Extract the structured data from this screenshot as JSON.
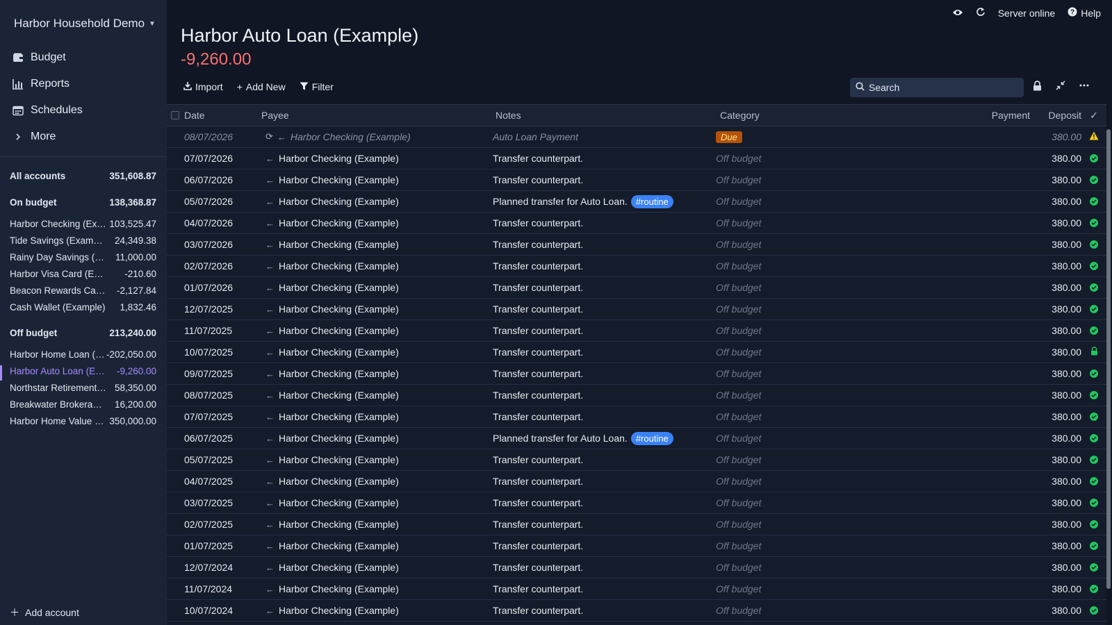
{
  "sidebar": {
    "budget_name": "Harbor Household Demo",
    "nav": [
      {
        "label": "Budget",
        "icon": "wallet-icon"
      },
      {
        "label": "Reports",
        "icon": "bar-chart-icon"
      },
      {
        "label": "Schedules",
        "icon": "calendar-icon"
      },
      {
        "label": "More",
        "icon": "chevron-right-icon"
      }
    ],
    "all_accounts": {
      "name": "All accounts",
      "balance": "351,608.87"
    },
    "on_budget": {
      "name": "On budget",
      "balance": "138,368.87"
    },
    "on_budget_accounts": [
      {
        "name": "Harbor Checking (Example)",
        "balance": "103,525.47"
      },
      {
        "name": "Tide Savings (Example)",
        "balance": "24,349.38"
      },
      {
        "name": "Rainy Day Savings (Example)",
        "balance": "11,000.00"
      },
      {
        "name": "Harbor Visa Card (Example)",
        "balance": "-210.60"
      },
      {
        "name": "Beacon Rewards Card (Example)",
        "balance": "-2,127.84"
      },
      {
        "name": "Cash Wallet (Example)",
        "balance": "1,832.46"
      }
    ],
    "off_budget": {
      "name": "Off budget",
      "balance": "213,240.00"
    },
    "off_budget_accounts": [
      {
        "name": "Harbor Home Loan (Example)",
        "balance": "-202,050.00"
      },
      {
        "name": "Harbor Auto Loan (Example)",
        "balance": "-9,260.00"
      },
      {
        "name": "Northstar Retirement (Example)",
        "balance": "58,350.00"
      },
      {
        "name": "Breakwater Brokerage (Example)",
        "balance": "16,200.00"
      },
      {
        "name": "Harbor Home Value (Example)",
        "balance": "350,000.00"
      }
    ],
    "add_account": "Add account"
  },
  "topbar": {
    "server_status": "Server online",
    "help": "Help"
  },
  "account": {
    "title": "Harbor Auto Loan (Example)",
    "balance": "-9,260.00"
  },
  "toolbar": {
    "import": "Import",
    "add_new": "Add New",
    "filter": "Filter",
    "search_placeholder": "Search"
  },
  "columns": {
    "date": "Date",
    "payee": "Payee",
    "notes": "Notes",
    "category": "Category",
    "payment": "Payment",
    "deposit": "Deposit",
    "cleared": "✓"
  },
  "colors": {
    "accent": "#a78bfa",
    "negative": "#f87171",
    "tag": "#3b82f6",
    "cleared": "#22c55e",
    "due": "#b45309"
  },
  "transactions": [
    {
      "date": "08/07/2026",
      "payee": "Harbor Checking (Example)",
      "notes": "Auto Loan Payment",
      "tag": "",
      "category": "Due",
      "deposit": "380.00",
      "status": "warning",
      "scheduled": true
    },
    {
      "date": "07/07/2026",
      "payee": "Harbor Checking (Example)",
      "notes": "Transfer counterpart.",
      "tag": "",
      "category": "Off budget",
      "deposit": "380.00",
      "status": "cleared"
    },
    {
      "date": "06/07/2026",
      "payee": "Harbor Checking (Example)",
      "notes": "Transfer counterpart.",
      "tag": "",
      "category": "Off budget",
      "deposit": "380.00",
      "status": "cleared"
    },
    {
      "date": "05/07/2026",
      "payee": "Harbor Checking (Example)",
      "notes": "Planned transfer for Auto Loan.",
      "tag": "#routine",
      "category": "Off budget",
      "deposit": "380.00",
      "status": "cleared"
    },
    {
      "date": "04/07/2026",
      "payee": "Harbor Checking (Example)",
      "notes": "Transfer counterpart.",
      "tag": "",
      "category": "Off budget",
      "deposit": "380.00",
      "status": "cleared"
    },
    {
      "date": "03/07/2026",
      "payee": "Harbor Checking (Example)",
      "notes": "Transfer counterpart.",
      "tag": "",
      "category": "Off budget",
      "deposit": "380.00",
      "status": "cleared"
    },
    {
      "date": "02/07/2026",
      "payee": "Harbor Checking (Example)",
      "notes": "Transfer counterpart.",
      "tag": "",
      "category": "Off budget",
      "deposit": "380.00",
      "status": "cleared"
    },
    {
      "date": "01/07/2026",
      "payee": "Harbor Checking (Example)",
      "notes": "Transfer counterpart.",
      "tag": "",
      "category": "Off budget",
      "deposit": "380.00",
      "status": "cleared"
    },
    {
      "date": "12/07/2025",
      "payee": "Harbor Checking (Example)",
      "notes": "Transfer counterpart.",
      "tag": "",
      "category": "Off budget",
      "deposit": "380.00",
      "status": "cleared"
    },
    {
      "date": "11/07/2025",
      "payee": "Harbor Checking (Example)",
      "notes": "Transfer counterpart.",
      "tag": "",
      "category": "Off budget",
      "deposit": "380.00",
      "status": "cleared"
    },
    {
      "date": "10/07/2025",
      "payee": "Harbor Checking (Example)",
      "notes": "Transfer counterpart.",
      "tag": "",
      "category": "Off budget",
      "deposit": "380.00",
      "status": "locked"
    },
    {
      "date": "09/07/2025",
      "payee": "Harbor Checking (Example)",
      "notes": "Transfer counterpart.",
      "tag": "",
      "category": "Off budget",
      "deposit": "380.00",
      "status": "cleared"
    },
    {
      "date": "08/07/2025",
      "payee": "Harbor Checking (Example)",
      "notes": "Transfer counterpart.",
      "tag": "",
      "category": "Off budget",
      "deposit": "380.00",
      "status": "cleared"
    },
    {
      "date": "07/07/2025",
      "payee": "Harbor Checking (Example)",
      "notes": "Transfer counterpart.",
      "tag": "",
      "category": "Off budget",
      "deposit": "380.00",
      "status": "cleared"
    },
    {
      "date": "06/07/2025",
      "payee": "Harbor Checking (Example)",
      "notes": "Planned transfer for Auto Loan.",
      "tag": "#routine",
      "category": "Off budget",
      "deposit": "380.00",
      "status": "cleared"
    },
    {
      "date": "05/07/2025",
      "payee": "Harbor Checking (Example)",
      "notes": "Transfer counterpart.",
      "tag": "",
      "category": "Off budget",
      "deposit": "380.00",
      "status": "cleared"
    },
    {
      "date": "04/07/2025",
      "payee": "Harbor Checking (Example)",
      "notes": "Transfer counterpart.",
      "tag": "",
      "category": "Off budget",
      "deposit": "380.00",
      "status": "cleared"
    },
    {
      "date": "03/07/2025",
      "payee": "Harbor Checking (Example)",
      "notes": "Transfer counterpart.",
      "tag": "",
      "category": "Off budget",
      "deposit": "380.00",
      "status": "cleared"
    },
    {
      "date": "02/07/2025",
      "payee": "Harbor Checking (Example)",
      "notes": "Transfer counterpart.",
      "tag": "",
      "category": "Off budget",
      "deposit": "380.00",
      "status": "cleared"
    },
    {
      "date": "01/07/2025",
      "payee": "Harbor Checking (Example)",
      "notes": "Transfer counterpart.",
      "tag": "",
      "category": "Off budget",
      "deposit": "380.00",
      "status": "cleared"
    },
    {
      "date": "12/07/2024",
      "payee": "Harbor Checking (Example)",
      "notes": "Transfer counterpart.",
      "tag": "",
      "category": "Off budget",
      "deposit": "380.00",
      "status": "cleared"
    },
    {
      "date": "11/07/2024",
      "payee": "Harbor Checking (Example)",
      "notes": "Transfer counterpart.",
      "tag": "",
      "category": "Off budget",
      "deposit": "380.00",
      "status": "cleared"
    },
    {
      "date": "10/07/2024",
      "payee": "Harbor Checking (Example)",
      "notes": "Transfer counterpart.",
      "tag": "",
      "category": "Off budget",
      "deposit": "380.00",
      "status": "cleared"
    }
  ]
}
